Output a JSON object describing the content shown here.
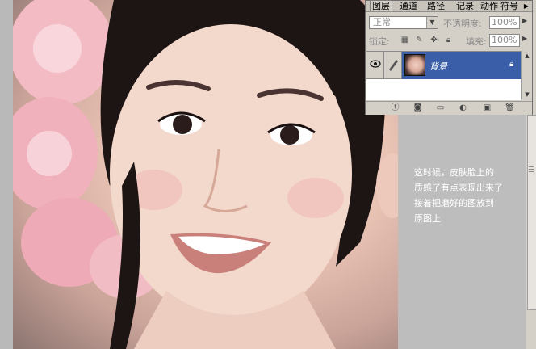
{
  "layers_panel": {
    "tabs": {
      "layers": "图层",
      "channels": "通道",
      "paths": "路径",
      "history": "记录",
      "actions": "动作",
      "tool": "符号"
    },
    "blend_mode": "正常",
    "opacity_label": "不透明度:",
    "opacity_value": "100%",
    "lock_label": "锁定:",
    "fill_label": "填充:",
    "fill_value": "100%",
    "layer": {
      "name": "背景"
    }
  },
  "annotation": {
    "line1": "这时候，皮肤脸上的",
    "line2": "质感了有点表现出来了",
    "line3": "接着把磨好的图放到",
    "line4": "原图上"
  },
  "colors": {
    "panel_bg": "#d4d0c8",
    "selected_layer": "#3a5ea8",
    "workspace": "#bdbdbd"
  }
}
